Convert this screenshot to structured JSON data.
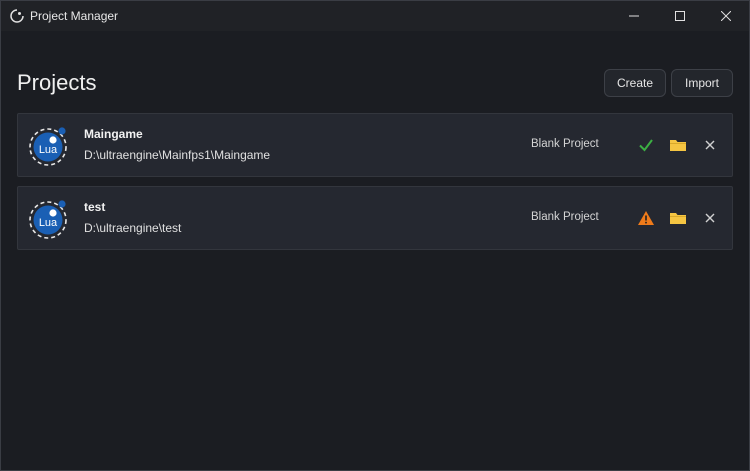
{
  "window": {
    "title": "Project Manager"
  },
  "header": {
    "title": "Projects",
    "create_label": "Create",
    "import_label": "Import"
  },
  "projects": [
    {
      "icon_label": "Lua",
      "name": "Maingame",
      "path": "D:\\ultraengine\\Mainfps1\\Maingame",
      "template": "Blank Project",
      "status": "ok",
      "status_icon": "checkmark-icon",
      "status_color": "#3cb043"
    },
    {
      "icon_label": "Lua",
      "name": "test",
      "path": "D:\\ultraengine\\test",
      "template": "Blank Project",
      "status": "warning",
      "status_icon": "warning-icon",
      "status_color": "#f07b1a"
    }
  ],
  "colors": {
    "lua_blue": "#1a5fb4",
    "folder_yellow": "#f5c542",
    "background": "#1b1d22",
    "card": "#252830"
  }
}
